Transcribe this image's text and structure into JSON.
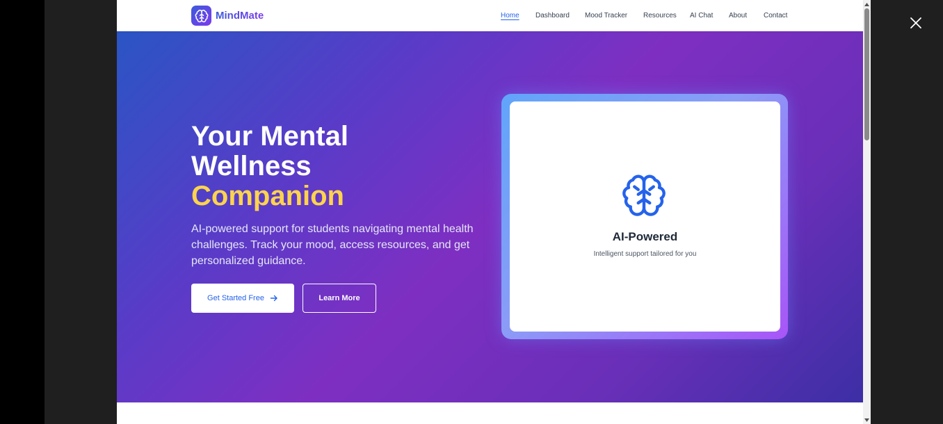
{
  "brand": {
    "name": "MindMate",
    "logo_icon": "brain-icon"
  },
  "nav": {
    "links": [
      {
        "label": "Home",
        "active": true
      },
      {
        "label": "Dashboard",
        "active": false
      },
      {
        "label": "Mood Tracker",
        "active": false
      },
      {
        "label": "Resources",
        "active": false
      },
      {
        "label": "AI Chat",
        "active": false
      },
      {
        "label": "About",
        "active": false
      },
      {
        "label": "Contact",
        "active": false
      }
    ]
  },
  "hero": {
    "title_line1": "Your Mental",
    "title_line2": "Wellness",
    "title_highlight": "Companion",
    "description": "AI-powered support for students navigating mental health challenges. Track your mood, access resources, and get personalized guidance.",
    "primary_button": "Get Started Free",
    "secondary_button": "Learn More"
  },
  "feature_card": {
    "icon": "brain-icon",
    "title": "AI-Powered",
    "subtitle": "Intelligent support tailored for you"
  },
  "colors": {
    "accent": "#2563eb",
    "highlight": "#fcd34d",
    "brand_gradient_start": "#3b5bdb",
    "brand_gradient_end": "#7c3aed"
  }
}
